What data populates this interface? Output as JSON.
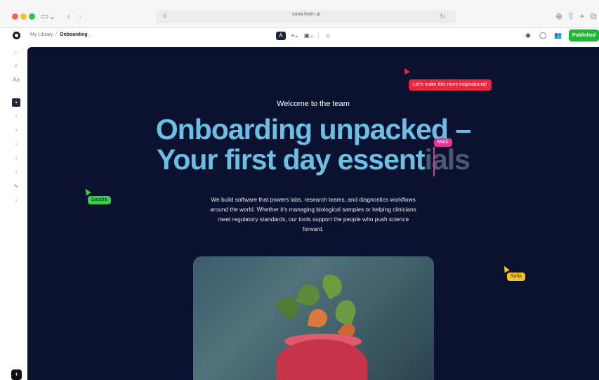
{
  "browser": {
    "url": "sana.learn.ai",
    "icons": [
      "sidebar-icon",
      "back-icon",
      "forward-icon",
      "download-icon",
      "share-icon",
      "new-tab-icon",
      "tabs-icon"
    ]
  },
  "toolbar": {
    "breadcrumb_root": "My Library",
    "breadcrumb_sep": "/",
    "breadcrumb_current": "Onboarding",
    "publish_label": "Published"
  },
  "document": {
    "eyebrow": "Welcome to the team",
    "headline_line1": "Onboarding unpacked –",
    "headline_line2_main": "Your first day essent",
    "headline_line2_faded": "ials",
    "body": "We build software that powers labs, research teams, and diagnostics workflows around the world. Whether it’s managing biological samples or helping clinicians meet regulatory standards, our tools support the people who push science forward."
  },
  "collaborators": {
    "comment": "Let's make this more inspirational!",
    "sandra": "Sandra",
    "mark": "Mark",
    "sofia": "Sofia"
  },
  "colors": {
    "canvas_bg": "#0b1230",
    "headline": "#6cbfe4",
    "publish": "#22b43a",
    "comment": "#e8283b",
    "sandra": "#3bc94f",
    "mark": "#e0389a",
    "sofia": "#f4c425"
  }
}
